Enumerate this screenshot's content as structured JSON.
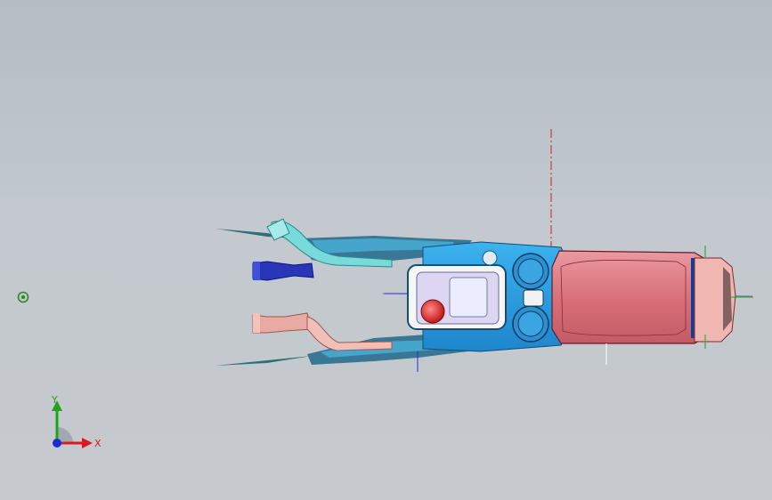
{
  "window": {
    "title": ""
  },
  "triad": {
    "x_label": "X",
    "y_label": "Y"
  },
  "colors": {
    "background_top": "#b4bcc4",
    "background_bottom": "#c6c9cd",
    "console_blue": "#2f9fe0",
    "armrest_red": "#d97a80",
    "hose_cyan": "#6fd6d6",
    "knob_blue": "#2a36b8",
    "knob_pink": "#e8a8a0",
    "axis_x": "#d81b1b",
    "axis_y": "#1aa81a",
    "axis_z": "#1a2ad8"
  },
  "icons": {
    "origin": "origin-marker-icon",
    "triad": "coordinate-triad-icon"
  }
}
